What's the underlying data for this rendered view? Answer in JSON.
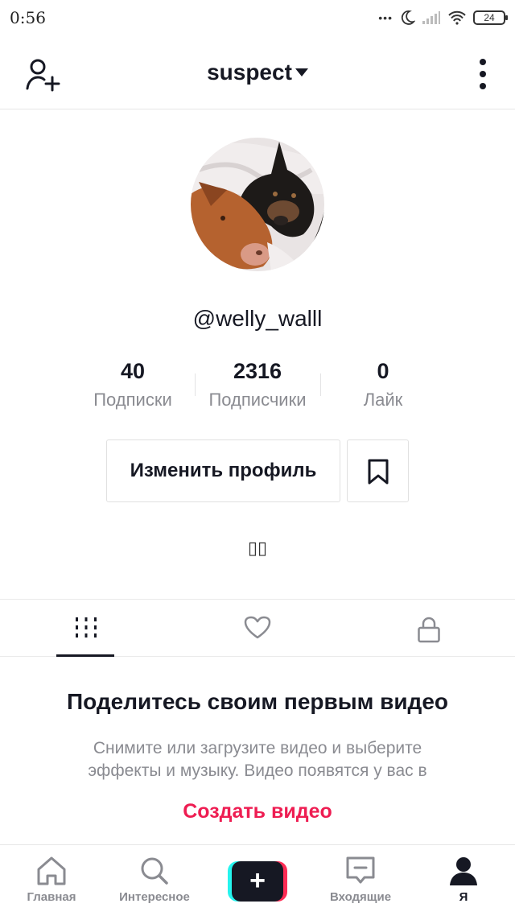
{
  "status_bar": {
    "time": "0:56",
    "battery": "24"
  },
  "header": {
    "account_name": "suspect"
  },
  "profile": {
    "username": "@welly_walll",
    "stats": [
      {
        "value": "40",
        "label": "Подписки"
      },
      {
        "value": "2316",
        "label": "Подписчики"
      },
      {
        "value": "0",
        "label": "Лайк"
      }
    ],
    "edit_button_label": "Изменить профиль",
    "bio_glyph": "▯▯"
  },
  "tabs": {
    "active": "videos",
    "items": [
      "videos-grid-icon",
      "heart-icon",
      "lock-icon"
    ]
  },
  "empty_state": {
    "heading": "Поделитесь своим первым видео",
    "text": "Снимите или загрузите видео и выберите эффекты и музыку. Видео появятся у вас в",
    "cta": "Создать видео"
  },
  "bottom_nav": {
    "items": [
      {
        "label": "Главная",
        "icon": "home-icon"
      },
      {
        "label": "Интересное",
        "icon": "search-icon"
      },
      {
        "label": "",
        "icon": "plus-icon"
      },
      {
        "label": "Входящие",
        "icon": "inbox-icon"
      },
      {
        "label": "Я",
        "icon": "profile-icon"
      }
    ],
    "active_index": 4
  },
  "colors": {
    "accent": "#ee1d52",
    "text": "#161823",
    "muted": "#8a8b91"
  }
}
